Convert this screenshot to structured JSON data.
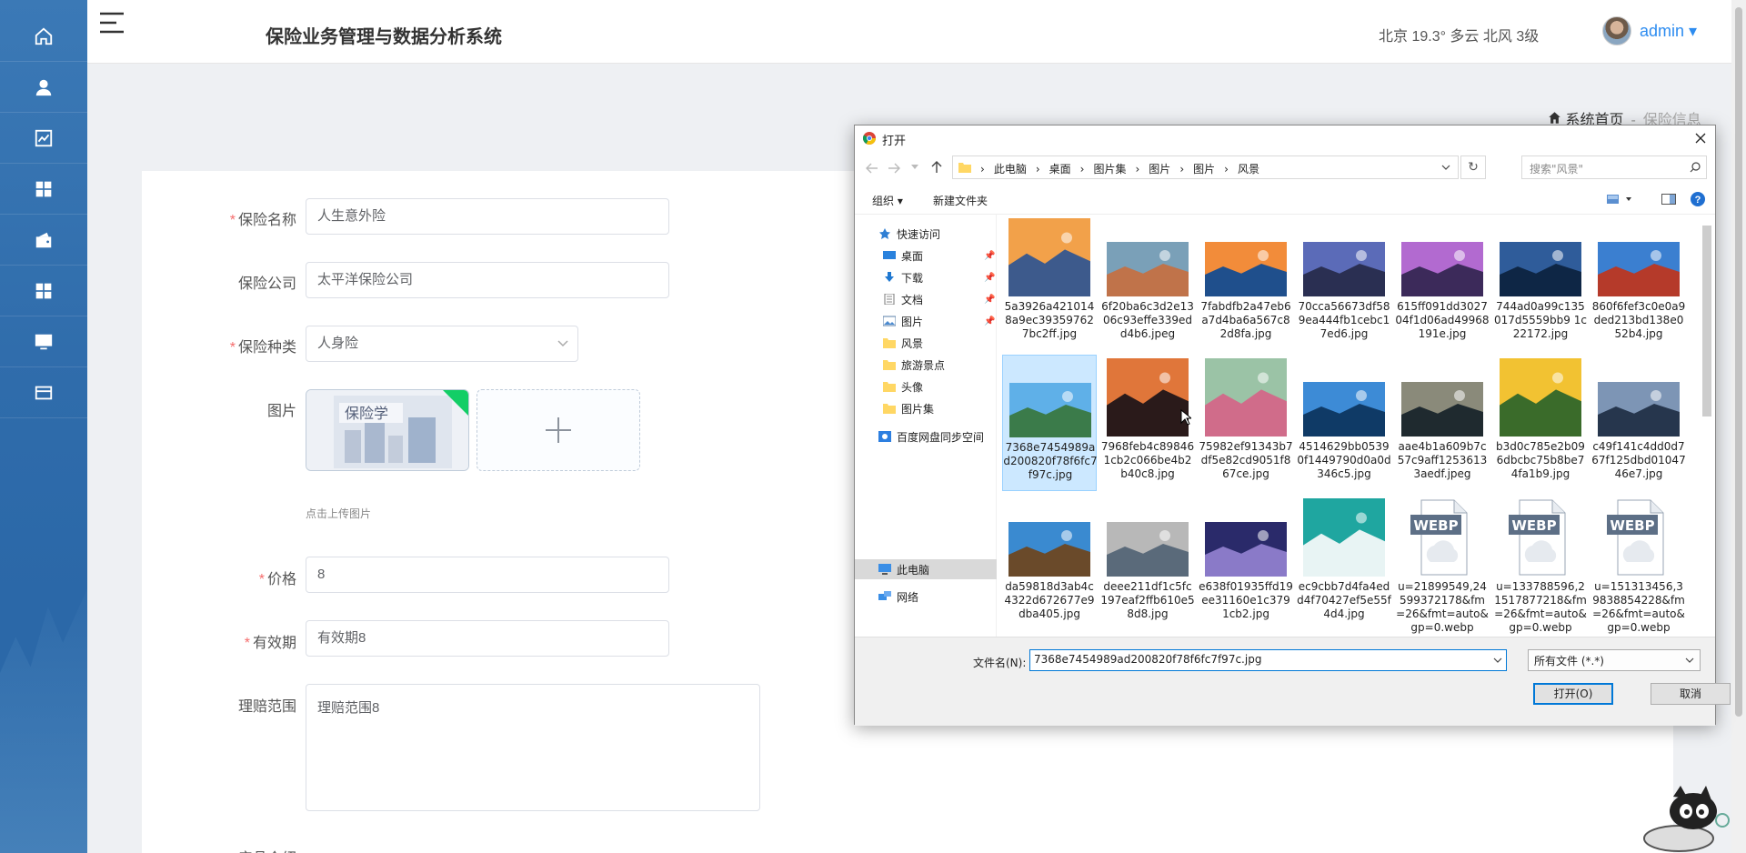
{
  "header": {
    "system_title": "保险业务管理与数据分析系统",
    "weather": "北京  19.3°  多云  北风  3级",
    "user": "admin ▾"
  },
  "sidebar": {
    "items": [
      "home-icon",
      "user-icon",
      "chart-line-icon",
      "dashboard-icon",
      "wallet-icon",
      "grid-icon",
      "monitor-icon",
      "card-icon"
    ]
  },
  "breadcrumb": {
    "home": "系统首页",
    "current": "保险信息"
  },
  "form": {
    "name": {
      "label": "保险名称",
      "value": "人生意外险"
    },
    "company": {
      "label": "保险公司",
      "value": "太平洋保险公司"
    },
    "category": {
      "label": "保险种类",
      "value": "人身险"
    },
    "image": {
      "label": "图片",
      "hint": "点击上传图片"
    },
    "price": {
      "label": "价格",
      "value": "8"
    },
    "validity": {
      "label": "有效期",
      "value": "有效期8"
    },
    "claims": {
      "label": "理赔范围",
      "value": "理赔范围8"
    },
    "next_label": "产品介绍"
  },
  "dialog": {
    "title": "打开",
    "path": [
      "此电脑",
      "桌面",
      "图片集",
      "图片",
      "图片",
      "风景"
    ],
    "search_placeholder": "搜索\"风景\"",
    "organize": "组织 ▾",
    "new_folder": "新建文件夹",
    "tree": [
      {
        "label": "快速访问"
      },
      {
        "label": "桌面",
        "pinned": true
      },
      {
        "label": "下载",
        "pinned": true
      },
      {
        "label": "文档",
        "pinned": true
      },
      {
        "label": "图片",
        "pinned": true
      },
      {
        "label": "风景"
      },
      {
        "label": "旅游景点"
      },
      {
        "label": "头像"
      },
      {
        "label": "图片集"
      },
      {
        "label": "百度网盘同步空间"
      },
      {
        "label": "此电脑"
      },
      {
        "label": "网络"
      }
    ],
    "files": [
      "5a3926a4210148a9ec393597627bc2ff.jpg",
      "6f20ba6c3d2e1306c93effe339edd4b6.jpeg",
      "7fabdfb2a47eb6a7d4ba6a567c82d8fa.jpg",
      "70cca56673df589ea444fb1cebc17ed6.jpg",
      "615ff091dd302704f1d06ad49968191e.jpg",
      "744ad0a99c135017d5559bb9 1c22172.jpg",
      "860f6fef3c0e0a9ded213bd138e052b4.jpg",
      "7368e7454989ad200820f78f6fc7f97c.jpg",
      "7968feb4c898461cb2c066be4b2b40c8.jpg",
      "75982ef91343b7df5e82cd9051f867ce.jpg",
      "4514629bb05390f1449790d0a0d346c5.jpg",
      "aae4b1a609b7c57c9aff12536133aedf.jpeg",
      "b3d0c785e2b096dbcbc75b8be74fa1b9.jpg",
      "c49f141c4dd0d767f125dbd0104746e7.jpg",
      "da59818d3ab4c4322d672677e9dba405.jpg",
      "deee211df1c5fc197eaf2ffb610e58d8.jpg",
      "e638f01935ffd19ee31160e1c3791cb2.jpg",
      "ec9cbb7d4fa4edd4f70427ef5e55f4d4.jpg",
      "u=21899549,24599372178&fm=26&fmt=auto&gp=0.webp",
      "u=133788596,21517877218&fm=26&fmt=auto&gp=0.webp",
      "u=151313456,39838854228&fm=26&fmt=auto&gp=0.webp"
    ],
    "filename_label": "文件名(N):",
    "filename_value": "7368e7454989ad200820f78f6fc7f97c.jpg",
    "filter": "所有文件 (*.*)",
    "open": "打开(O)",
    "cancel": "取消",
    "webp_badge": "WEBP"
  },
  "colors": {
    "sidebar": "#2f6cab",
    "accent": "#2d8cf0",
    "required": "#f56c6c",
    "selection": "#cce8ff"
  }
}
